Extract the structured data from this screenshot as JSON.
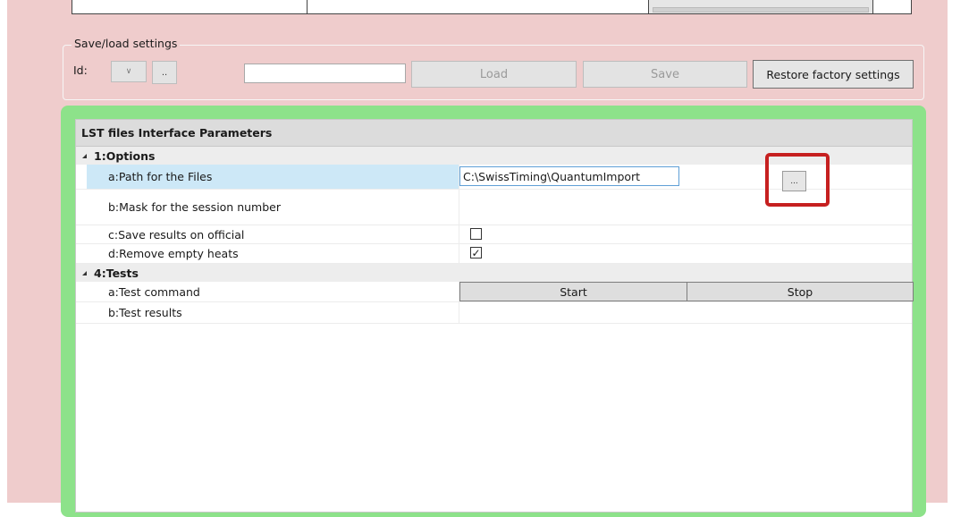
{
  "save_load": {
    "group_title": "Save/load settings",
    "id_label": "Id:",
    "id_select_icon": "chevron-down-icon",
    "dots_label": "..",
    "id_input_value": "",
    "load_label": "Load",
    "save_label": "Save",
    "restore_label": "Restore factory settings"
  },
  "grid": {
    "header": "LST files Interface Parameters",
    "categories": [
      {
        "label": "1:Options",
        "rows": [
          {
            "name": "a:Path for the Files",
            "value": "C:\\SwissTiming\\QuantumImport",
            "browse_label": "..."
          },
          {
            "name": "b:Mask for the session number",
            "value": ""
          },
          {
            "name": "c:Save results on official",
            "checked": false
          },
          {
            "name": "d:Remove empty heats",
            "checked": true,
            "check_glyph": "✓"
          }
        ]
      },
      {
        "label": "4:Tests",
        "rows": [
          {
            "name": "a:Test command",
            "start_label": "Start",
            "stop_label": "Stop"
          },
          {
            "name": "b:Test results",
            "value": ""
          }
        ]
      }
    ]
  },
  "colors": {
    "background_pink": "#efcccc",
    "panel_green": "#8de28a",
    "selection_blue": "#cde8f7",
    "highlight_red": "#c62020"
  }
}
